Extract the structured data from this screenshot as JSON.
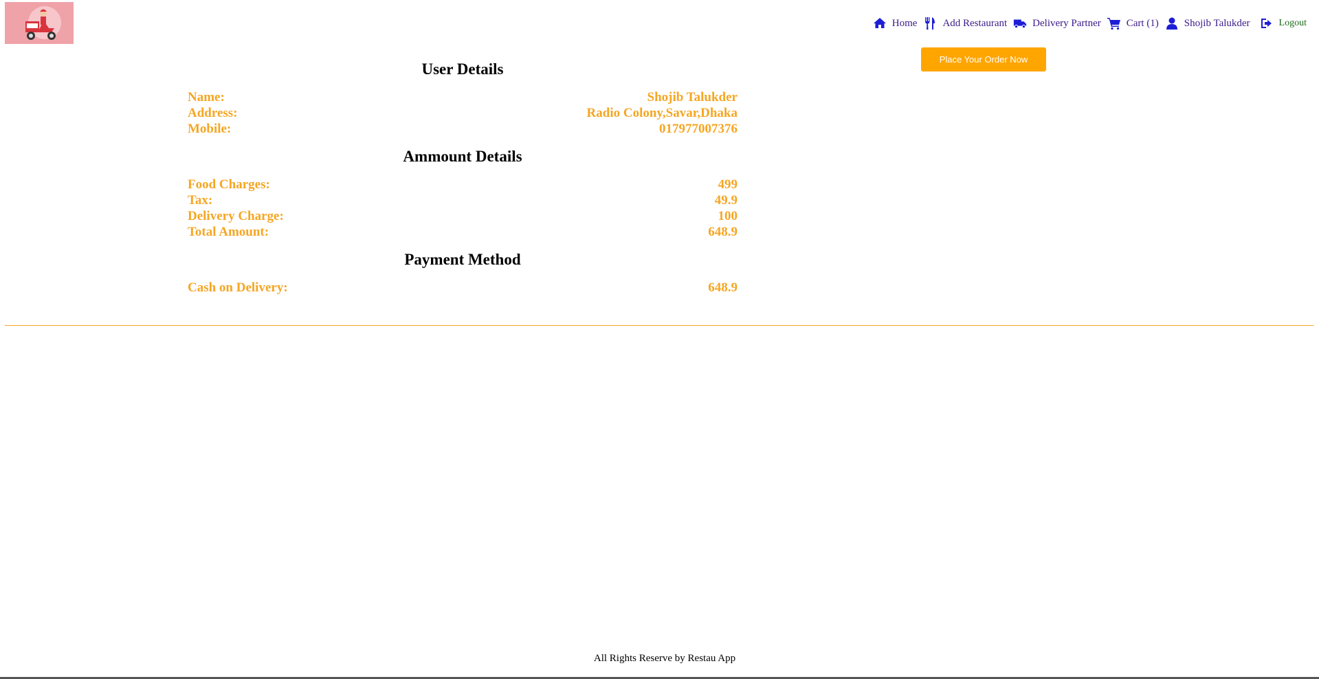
{
  "header": {
    "logo_alt": "",
    "nav": {
      "home": "Home",
      "add_restaurant": "Add Restaurant",
      "delivery_partner": "Delivery Partner",
      "cart": "Cart (1)",
      "user": "Shojib Talukder",
      "logout": "Logout"
    },
    "icons": {
      "home": "home-icon",
      "add_restaurant": "fork-knife-icon",
      "delivery_partner": "truck-icon",
      "cart": "cart-icon",
      "user": "user-icon",
      "logout": "logout-icon"
    },
    "colors": {
      "icon": "#1e1ed6",
      "nav_text": "#3b1a8a",
      "logout_text": "#1a6b1a"
    }
  },
  "order_button": {
    "label": "Place Your Order Now",
    "color": "#ffa500"
  },
  "user_details": {
    "title": "User Details",
    "rows": [
      {
        "label": "Name:",
        "value": "Shojib Talukder"
      },
      {
        "label": "Address:",
        "value": "Radio Colony,Savar,Dhaka"
      },
      {
        "label": "Mobile:",
        "value": "017977007376"
      }
    ]
  },
  "amount_details": {
    "title": "Ammount Details",
    "rows": [
      {
        "label": "Food Charges:",
        "value": "499"
      },
      {
        "label": "Tax:",
        "value": "49.9"
      },
      {
        "label": "Delivery Charge:",
        "value": "100"
      },
      {
        "label": "Total Amount:",
        "value": "648.9"
      }
    ]
  },
  "payment_method": {
    "title": "Payment Method",
    "rows": [
      {
        "label": "Cash on Delivery:",
        "value": "648.9"
      }
    ]
  },
  "footer": {
    "text": "All Rights Reserve by Restau App"
  },
  "accent_color": "#f5a623"
}
